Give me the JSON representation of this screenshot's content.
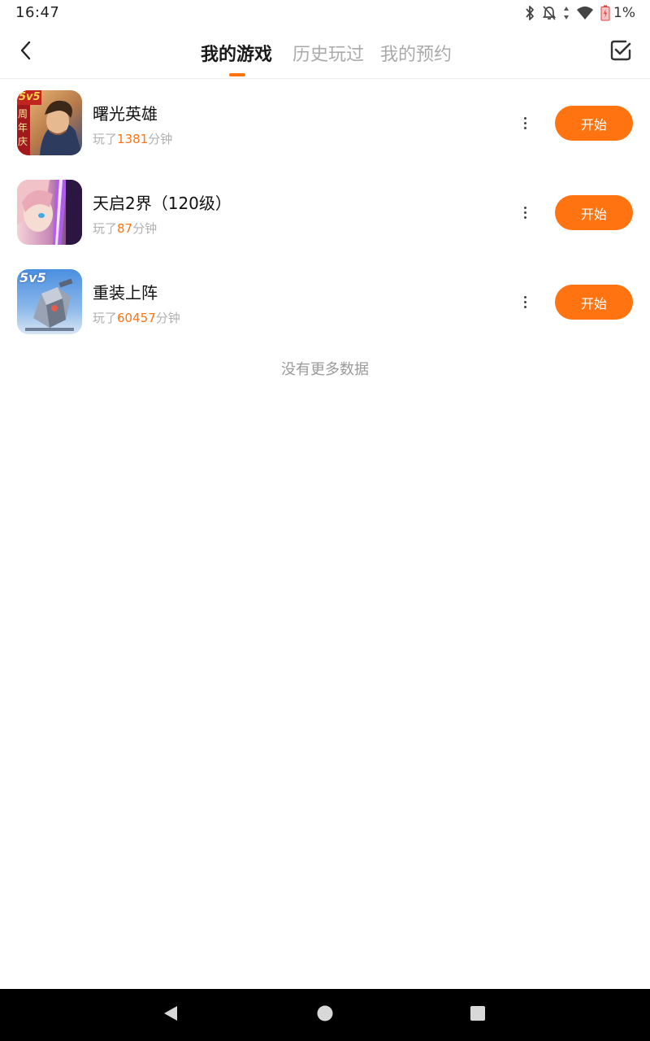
{
  "status_bar": {
    "time": "16:47",
    "battery_text": "1%",
    "icons": [
      "bluetooth-icon",
      "notifications-off-icon",
      "data-arrows-icon",
      "wifi-icon",
      "battery-low-icon"
    ]
  },
  "header": {
    "back_icon": "chevron-left-icon",
    "tabs": [
      {
        "label": "我的游戏",
        "active": true
      },
      {
        "label": "历史玩过",
        "active": false
      },
      {
        "label": "我的预约",
        "active": false
      }
    ],
    "manage_icon": "checkbox-checked-icon",
    "accent_color": "#ff7310"
  },
  "games": [
    {
      "title": "曙光英雄",
      "played_prefix": "玩了",
      "played_minutes": "1381",
      "played_suffix": "分钟",
      "icon_badge": "5v5",
      "icon_side_text": "周年庆",
      "start_label": "开始",
      "more_icon": "more-vertical-icon"
    },
    {
      "title": "天启2界（120级）",
      "played_prefix": "玩了",
      "played_minutes": "87",
      "played_suffix": "分钟",
      "start_label": "开始",
      "more_icon": "more-vertical-icon"
    },
    {
      "title": "重装上阵",
      "played_prefix": "玩了",
      "played_minutes": "60457",
      "played_suffix": "分钟",
      "icon_badge": "5v5",
      "start_label": "开始",
      "more_icon": "more-vertical-icon"
    }
  ],
  "list_footer": "没有更多数据",
  "nav_bar": {
    "icons": [
      "back-triangle-icon",
      "home-circle-icon",
      "recents-square-icon"
    ]
  },
  "colors": {
    "accent": "#ff7310",
    "text_primary": "#111111",
    "text_secondary": "#b0b0b0"
  }
}
